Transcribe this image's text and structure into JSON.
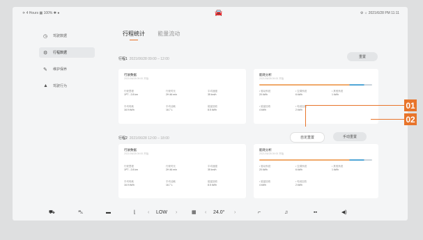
{
  "status_bar": {
    "left": "✈ 4 Hours   ▦ 100%   ✱  ●",
    "center_icon": "car-icon",
    "right": "⚙  ☼   2021/6/28  PM 11:11"
  },
  "sidebar": {
    "items": [
      {
        "icon": "clock-icon",
        "label": "驾驶数据"
      },
      {
        "icon": "gear-icon",
        "label": "行程数据"
      },
      {
        "icon": "wrench-icon",
        "label": "维护保养"
      },
      {
        "icon": "car-icon",
        "label": "驾驶行为"
      }
    ]
  },
  "tabs": [
    {
      "label": "行程统计"
    },
    {
      "label": "能量流动"
    }
  ],
  "trip1": {
    "title": "行程1",
    "subtitle": "2021/06/28 09:00 – 12:00",
    "button": "重置"
  },
  "trip2": {
    "title": "行程2",
    "subtitle": "2021/06/28 12:00 – 18:00",
    "button_left": "自定重置",
    "button_right": "手动重置"
  },
  "card_left": {
    "header": "行驶数据",
    "subheader": "2021/06/28 09:00 开始",
    "cells": [
      {
        "label": "行驶里程",
        "value": "1PT - 2.8 km"
      },
      {
        "label": "行驶时长",
        "value": "2H 46 min"
      },
      {
        "label": "平均速度",
        "value": "35 km/h"
      },
      {
        "label": "平均电耗",
        "value": "16.9 kWh"
      },
      {
        "label": "平均油耗",
        "value": "16.7 L"
      },
      {
        "label": "能量回收",
        "value": "8.5 kWh"
      }
    ]
  },
  "card_right": {
    "header": "能耗分析",
    "subheader": "2021/06/28 09:00 开始",
    "cells": [
      {
        "label": "• 驱动系统",
        "value": "20 kWh"
      },
      {
        "label": "• 空调系统",
        "value": "6 kWh"
      },
      {
        "label": "• 其他系统",
        "value": "1 kWh"
      },
      {
        "label": "• 能量回收",
        "value": "4 kWh"
      },
      {
        "label": "• 电池加热",
        "value": "2 kWh"
      }
    ]
  },
  "callouts": [
    "01",
    "02"
  ],
  "dock": {
    "fan_level": "LOW",
    "temperature": "24.0°",
    "dec": "‹",
    "inc": "›"
  },
  "colors": {
    "accent": "#e8742a",
    "blue": "#4fa6d6"
  }
}
